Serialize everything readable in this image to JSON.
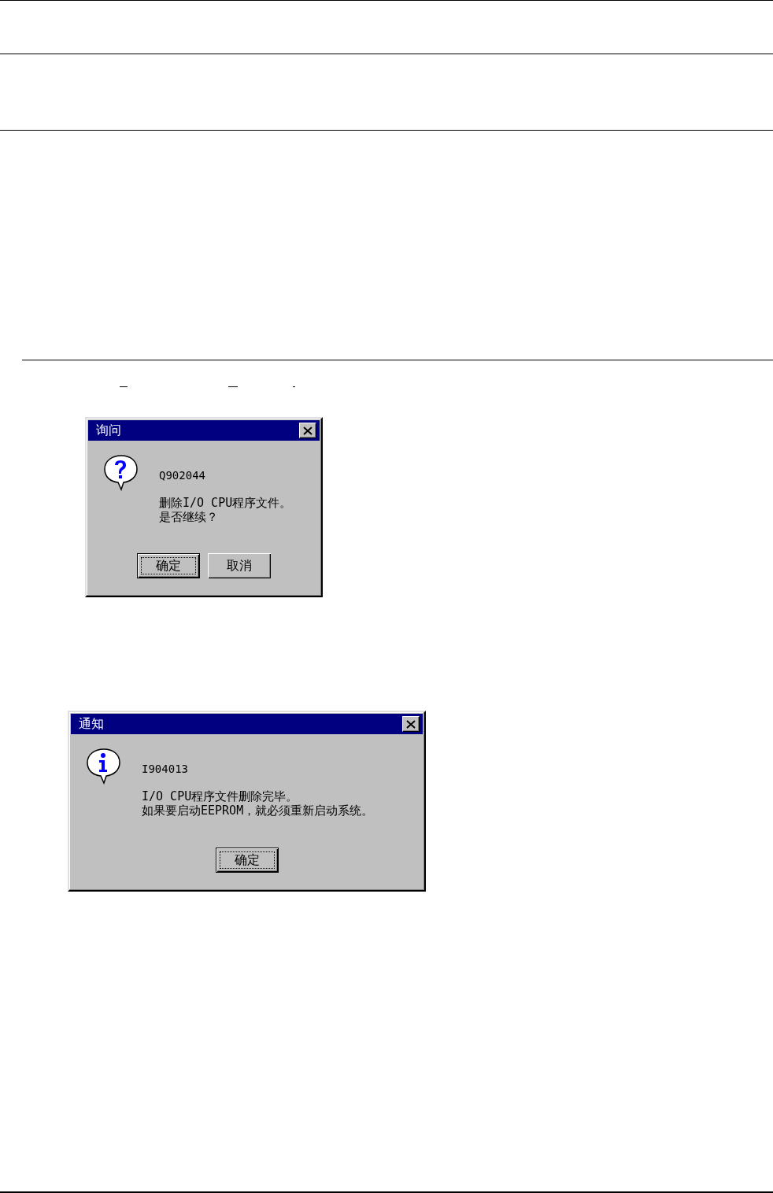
{
  "dialogs": [
    {
      "title": "询问",
      "kind": "question",
      "code": "Q902044",
      "message": [
        "删除I/O CPU程序文件。",
        "是否继续？"
      ],
      "buttons": [
        {
          "label": "确定",
          "focused": true
        },
        {
          "label": "取消",
          "focused": false
        }
      ]
    },
    {
      "title": "通知",
      "kind": "info",
      "code": "I904013",
      "message": [
        "I/O CPU程序文件删除完毕。",
        "如果要启动EEPROM，就必须重新启动系统。"
      ],
      "buttons": [
        {
          "label": "确定",
          "focused": true
        }
      ]
    }
  ]
}
